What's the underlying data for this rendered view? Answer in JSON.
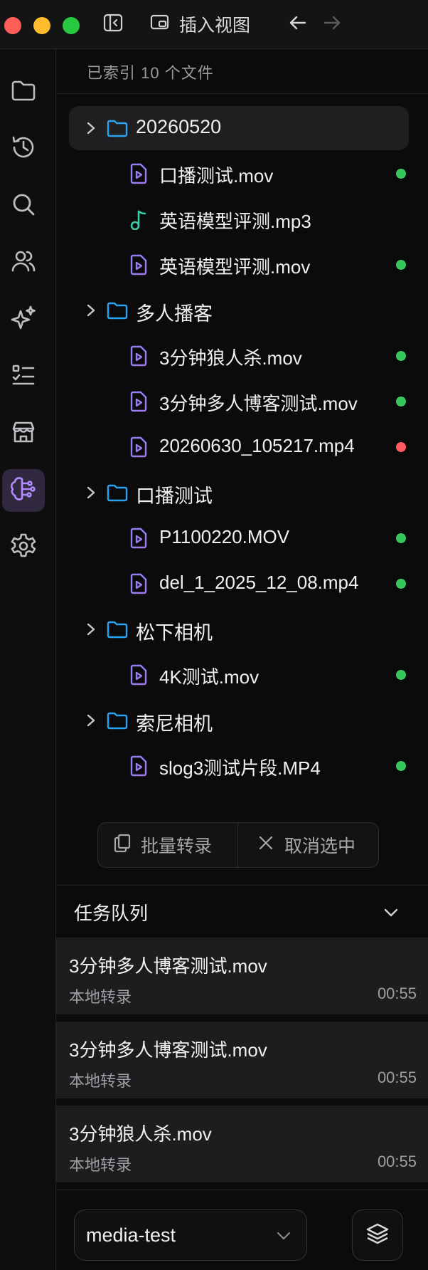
{
  "titlebar": {
    "insert_view_label": "插入视图",
    "traffic_lights": {
      "close": "#ff5f57",
      "minimize": "#febc2e",
      "zoom": "#28c840"
    },
    "icons": [
      "sidebar-toggle-icon",
      "insert-view-icon",
      "back-arrow-icon",
      "forward-arrow-icon"
    ]
  },
  "sidebar": {
    "items": [
      {
        "icon": "folder-icon"
      },
      {
        "icon": "history-icon"
      },
      {
        "icon": "search-icon"
      },
      {
        "icon": "users-icon"
      },
      {
        "icon": "sparkles-icon"
      },
      {
        "icon": "checklist-icon"
      },
      {
        "icon": "store-icon"
      },
      {
        "icon": "brain-icon",
        "active": true
      },
      {
        "icon": "gear-icon"
      }
    ]
  },
  "explorer": {
    "index_status": "已索引 10 个文件",
    "folders": [
      {
        "name": "20260520",
        "selected": true,
        "files": [
          {
            "name": "口播测试.mov",
            "icon": "video-file-icon",
            "status": "green"
          },
          {
            "name": "英语模型评测.mp3",
            "icon": "music-note-icon",
            "status": "none"
          },
          {
            "name": "英语模型评测.mov",
            "icon": "video-file-icon",
            "status": "green"
          }
        ]
      },
      {
        "name": "多人播客",
        "files": [
          {
            "name": "3分钟狼人杀.mov",
            "icon": "video-file-icon",
            "status": "green"
          },
          {
            "name": "3分钟多人博客测试.mov",
            "icon": "video-file-icon",
            "status": "green"
          },
          {
            "name": "20260630_105217.mp4",
            "icon": "video-file-icon",
            "status": "red"
          }
        ]
      },
      {
        "name": "口播测试",
        "files": [
          {
            "name": "P1100220.MOV",
            "icon": "video-file-icon",
            "status": "green"
          },
          {
            "name": "del_1_2025_12_08.mp4",
            "icon": "video-file-icon",
            "status": "green"
          }
        ]
      },
      {
        "name": "松下相机",
        "files": [
          {
            "name": "4K测试.mov",
            "icon": "video-file-icon",
            "status": "green"
          }
        ]
      },
      {
        "name": "索尼相机",
        "files": [
          {
            "name": "slog3测试片段.MP4",
            "icon": "video-file-icon",
            "status": "green"
          }
        ]
      }
    ],
    "actions": {
      "batch_transcribe": "批量转录",
      "cancel_selection": "取消选中"
    }
  },
  "queue": {
    "title": "任务队列",
    "tasks": [
      {
        "name": "3分钟多人博客测试.mov",
        "type": "本地转录",
        "time": "00:55"
      },
      {
        "name": "3分钟多人博客测试.mov",
        "type": "本地转录",
        "time": "00:55"
      },
      {
        "name": "3分钟狼人杀.mov",
        "type": "本地转录",
        "time": "00:55"
      }
    ]
  },
  "footer": {
    "project": "media-test",
    "layers_icon": "layers-icon"
  },
  "colors": {
    "folder": "#2aa3f5",
    "video_file": "#9b7cf2",
    "music": "#3ec9a7",
    "status_green": "#34c759",
    "status_red": "#ff5a5f",
    "active_bg": "#30283f"
  }
}
